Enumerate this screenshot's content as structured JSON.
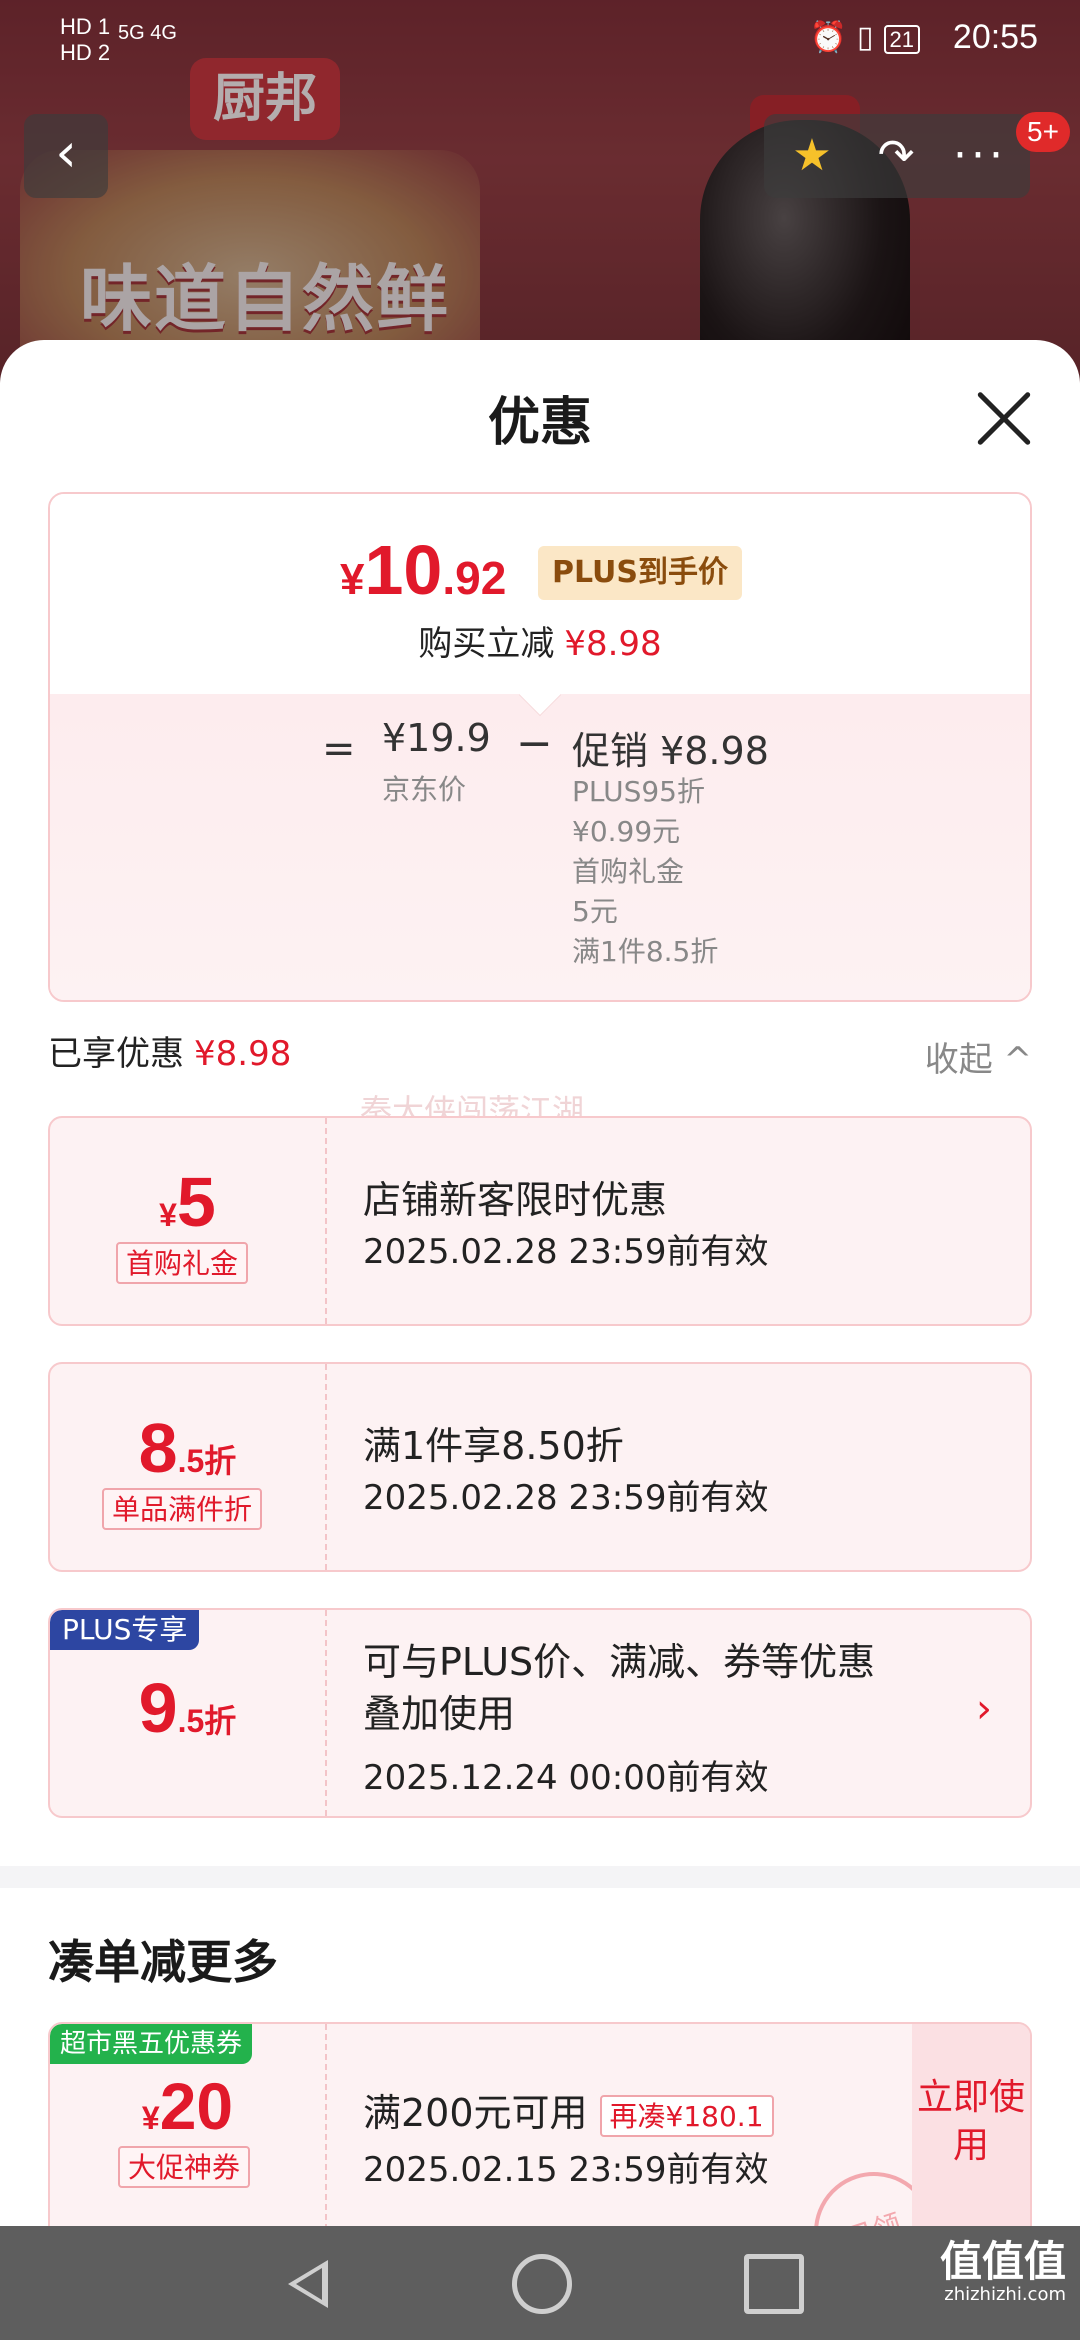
{
  "status": {
    "net1": "HD 1",
    "net2": "HD 2",
    "signal": "5G 4G",
    "battery": "21",
    "time": "20:55"
  },
  "banner": {
    "brand": "厨邦",
    "slogan": "味道自然鲜"
  },
  "nav": {
    "back_icon": "‹",
    "star_icon": "★",
    "share_icon": "↷",
    "more_icon": "···",
    "badge": "5+"
  },
  "sheet": {
    "title": "优惠"
  },
  "price": {
    "symbol": "¥",
    "final_int": "10",
    "final_dec": ".92",
    "plus_tag": "PLUS到手价",
    "reduce_label": "购买立减",
    "reduce_amount": "¥8.98",
    "equals": "=",
    "jd_price": "¥19.9",
    "jd_label": "京东价",
    "minus": "−",
    "promo_title": "促销 ¥8.98",
    "promo_lines": [
      "PLUS95折",
      "¥0.99元",
      "首购礼金",
      "5元",
      "满1件8.5折"
    ]
  },
  "enjoyed": {
    "label": "已享优惠",
    "amount": "¥8.98",
    "collapse": "收起 ^"
  },
  "watermark": "秦大侠闯荡江湖",
  "coupons": [
    {
      "amount_big": "5",
      "amount_prefix": "¥",
      "amount_suffix": "",
      "kind": "首购礼金",
      "desc": "店铺新客限时优惠",
      "date": "2025.02.28 23:59前有效"
    },
    {
      "amount_big": "8",
      "amount_prefix": "",
      "amount_suffix": ".5折",
      "kind": "单品满件折",
      "desc": "满1件享8.50折",
      "date": "2025.02.28 23:59前有效"
    },
    {
      "amount_big": "9",
      "amount_prefix": "",
      "amount_suffix": ".5折",
      "ribbon": "PLUS专享",
      "desc1": "可与PLUS价、满减、券等优惠",
      "desc2": "叠加使用",
      "date": "2025.12.24 00:00前有效",
      "chevron": "›"
    }
  ],
  "more": {
    "title": "凑单减更多",
    "tag": "超市黑五优惠券",
    "amount_prefix": "¥",
    "amount_big": "20",
    "kind": "大促神券",
    "desc": "满200元可用",
    "need": "再凑¥180.1",
    "date": "2025.02.15 23:59前有效",
    "use_now": "立即使用",
    "stamp": "已领"
  },
  "navbar": {
    "site": "值值值",
    "site_url": "zhizhizhi.com"
  },
  "colors": {
    "accent_red": "#e1192b",
    "plus_blue": "#2d46a2",
    "tag_green": "#23b24c"
  }
}
